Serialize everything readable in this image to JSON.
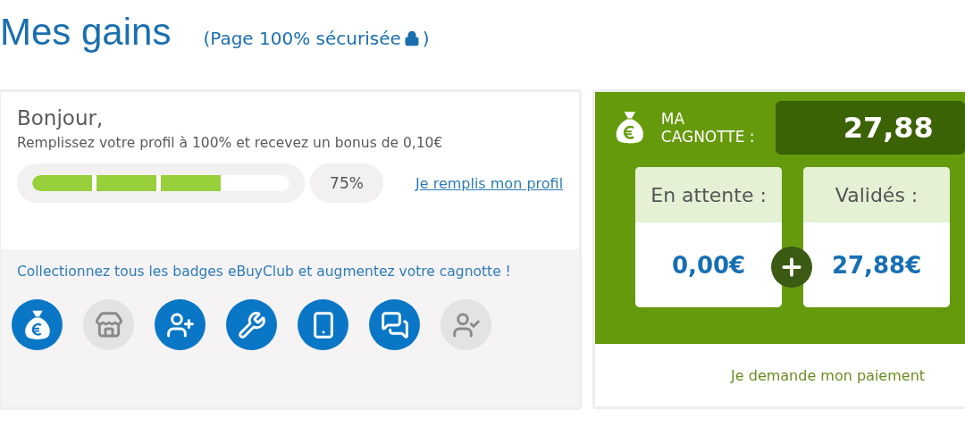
{
  "header": {
    "title": "Mes gains",
    "note": "(Page 100% sécurisée",
    " note_end": ")"
  },
  "profile": {
    "greeting": "Bonjour,",
    "message": "Remplissez votre profil à 100% et recevez un bonus de 0,10€",
    "progress": {
      "level": 0.75
    },
    "percent": "75%",
    "link": "Je remplis mon profil"
  },
  "badges": {
    "message": "Collectionnez tous les badges eBuyClub et augmentez votre cagnotte !",
    "items": [
      {
        "kind": "money",
        "earned": true
      },
      {
        "kind": "store",
        "earned": false
      },
      {
        "kind": "invite",
        "earned": true
      },
      {
        "kind": "wrench",
        "earned": true
      },
      {
        "kind": "phone",
        "earned": true
      },
      {
        "kind": "chat",
        "earned": true
      },
      {
        "kind": "user-check",
        "earned": false
      }
    ]
  },
  "cagnotte": {
    "label_line1": "MA",
    "label_line2": "CAGNOTTE :",
    "total": "27,88",
    "cards": [
      {
        "title": "En attente :",
        "amount": "0,00€"
      },
      {
        "title": "Validés :",
        "amount": "27,88€"
      }
    ],
    "payment_link": "Je demande mon paiement"
  }
}
